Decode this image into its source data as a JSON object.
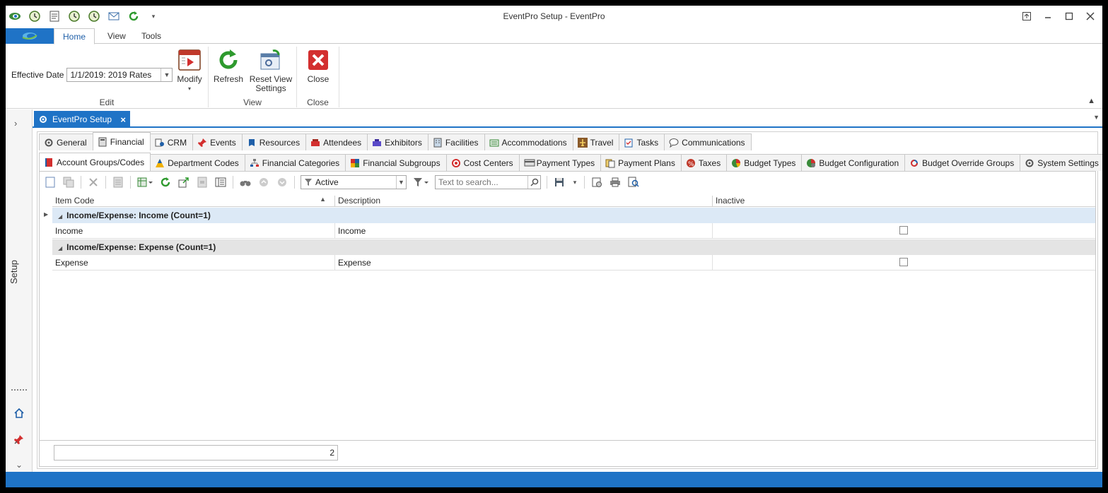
{
  "window": {
    "title": "EventPro Setup - EventPro",
    "qat_icons": [
      "eventpro-logo-icon",
      "clock-icon",
      "document-icon",
      "clock-icon",
      "clock-icon",
      "mail-icon",
      "refresh-icon",
      "qat-customize-icon"
    ]
  },
  "ribbon": {
    "tabs": [
      "Home",
      "View",
      "Tools"
    ],
    "active_tab": "Home",
    "edit_group": {
      "label": "Edit",
      "effective_date_label": "Effective Date",
      "effective_date_value": "1/1/2019: 2019 Rates",
      "modify_label": "Modify"
    },
    "view_group": {
      "label": "View",
      "refresh_label": "Refresh",
      "reset_label_line1": "Reset View",
      "reset_label_line2": "Settings"
    },
    "close_group": {
      "label": "Close",
      "close_label": "Close"
    }
  },
  "nav": {
    "label": "Setup"
  },
  "doc_tab": {
    "label": "EventPro Setup"
  },
  "main_tabs": [
    {
      "label": "General",
      "icon": "gear-icon"
    },
    {
      "label": "Financial",
      "icon": "calculator-icon"
    },
    {
      "label": "CRM",
      "icon": "crm-icon"
    },
    {
      "label": "Events",
      "icon": "pin-icon"
    },
    {
      "label": "Resources",
      "icon": "resources-icon"
    },
    {
      "label": "Attendees",
      "icon": "attendees-icon"
    },
    {
      "label": "Exhibitors",
      "icon": "exhibitors-icon"
    },
    {
      "label": "Facilities",
      "icon": "building-icon"
    },
    {
      "label": "Accommodations",
      "icon": "bed-icon"
    },
    {
      "label": "Travel",
      "icon": "plane-icon"
    },
    {
      "label": "Tasks",
      "icon": "clipboard-icon"
    },
    {
      "label": "Communications",
      "icon": "speech-bubble-icon"
    }
  ],
  "sub_tabs": [
    {
      "label": "Account Groups/Codes",
      "icon": "book-icon"
    },
    {
      "label": "Department Codes",
      "icon": "pyramid-icon"
    },
    {
      "label": "Financial Categories",
      "icon": "hierarchy-icon"
    },
    {
      "label": "Financial Subgroups",
      "icon": "color-grid-icon"
    },
    {
      "label": "Cost Centers",
      "icon": "target-icon"
    },
    {
      "label": "Payment Types",
      "icon": "credit-card-icon"
    },
    {
      "label": "Payment Plans",
      "icon": "payment-plan-icon"
    },
    {
      "label": "Taxes",
      "icon": "percent-icon"
    },
    {
      "label": "Budget Types",
      "icon": "pie-chart-icon"
    },
    {
      "label": "Budget Configuration",
      "icon": "budget-config-icon"
    },
    {
      "label": "Budget Override Groups",
      "icon": "override-icon"
    },
    {
      "label": "System Settings",
      "icon": "gear-icon"
    }
  ],
  "toolbar": {
    "filter_value": "Active",
    "search_placeholder": "Text to search..."
  },
  "grid": {
    "columns": [
      "Item Code",
      "Description",
      "Inactive"
    ],
    "groups": [
      {
        "label": "Income/Expense: Income (Count=1)",
        "rows": [
          {
            "item_code": "Income",
            "description": "Income",
            "inactive": false
          }
        ]
      },
      {
        "label": "Income/Expense: Expense (Count=1)",
        "rows": [
          {
            "item_code": "Expense",
            "description": "Expense",
            "inactive": false
          }
        ]
      }
    ],
    "footer_count": "2"
  },
  "colors": {
    "accent": "#1f73c6",
    "selected_group_bg": "#dce9f6",
    "group_bg": "#e4e4e4"
  }
}
